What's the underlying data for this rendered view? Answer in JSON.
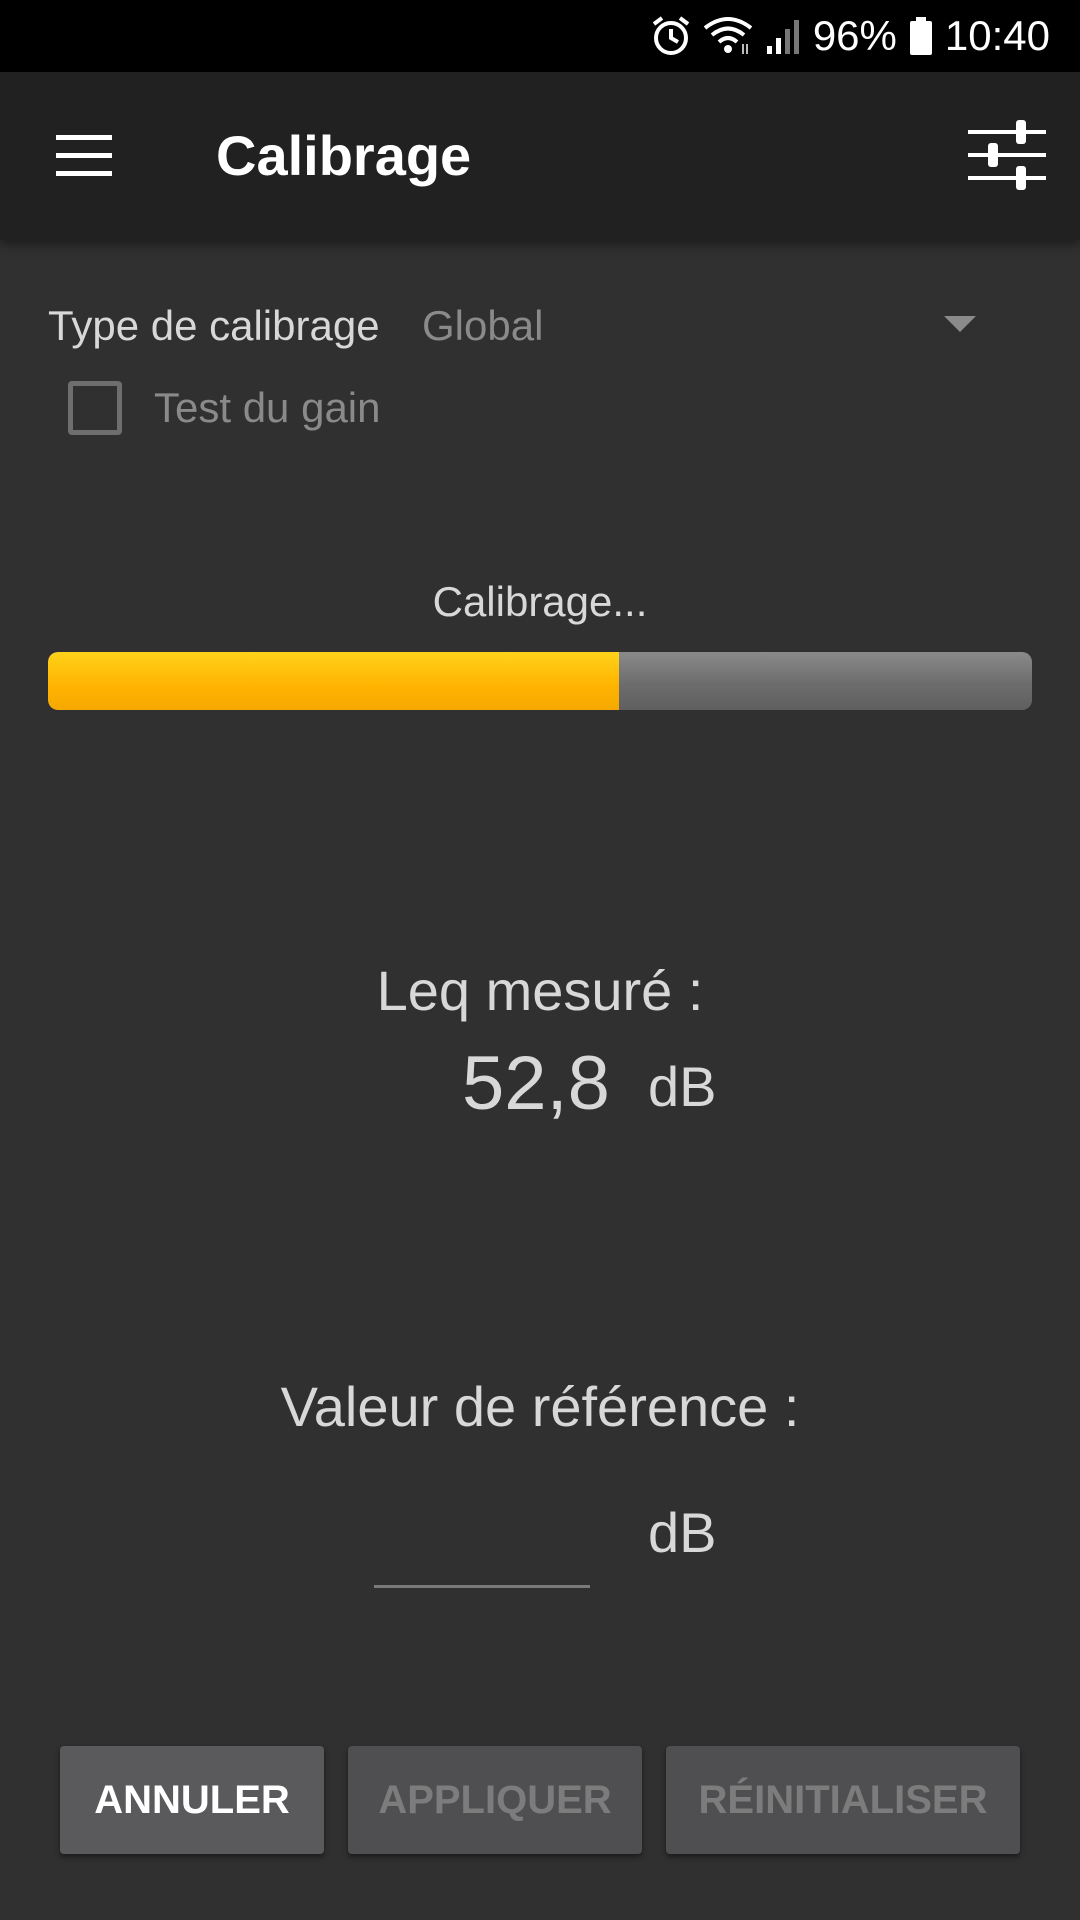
{
  "status_bar": {
    "battery": "96%",
    "time": "10:40",
    "icons": [
      "alarm-icon",
      "wifi-icon",
      "signal-icon",
      "battery-icon"
    ]
  },
  "toolbar": {
    "title": "Calibrage",
    "menu_icon": "menu-icon",
    "settings_icon": "sliders-icon"
  },
  "calibration_type": {
    "label": "Type de calibrage",
    "selected": "Global"
  },
  "gain_test": {
    "label": "Test du gain",
    "checked": false
  },
  "progress": {
    "label": "Calibrage...",
    "percent": 58
  },
  "measured": {
    "label": "Leq mesuré :",
    "value": "52,8",
    "unit": "dB"
  },
  "reference": {
    "label": "Valeur de référence :",
    "value": "",
    "unit": "dB"
  },
  "buttons": {
    "cancel": "ANNULER",
    "apply": "APPLIQUER",
    "reset": "RÉINITIALISER"
  },
  "colors": {
    "accent": "#ffb300",
    "background": "#303030",
    "toolbar": "#212121"
  }
}
